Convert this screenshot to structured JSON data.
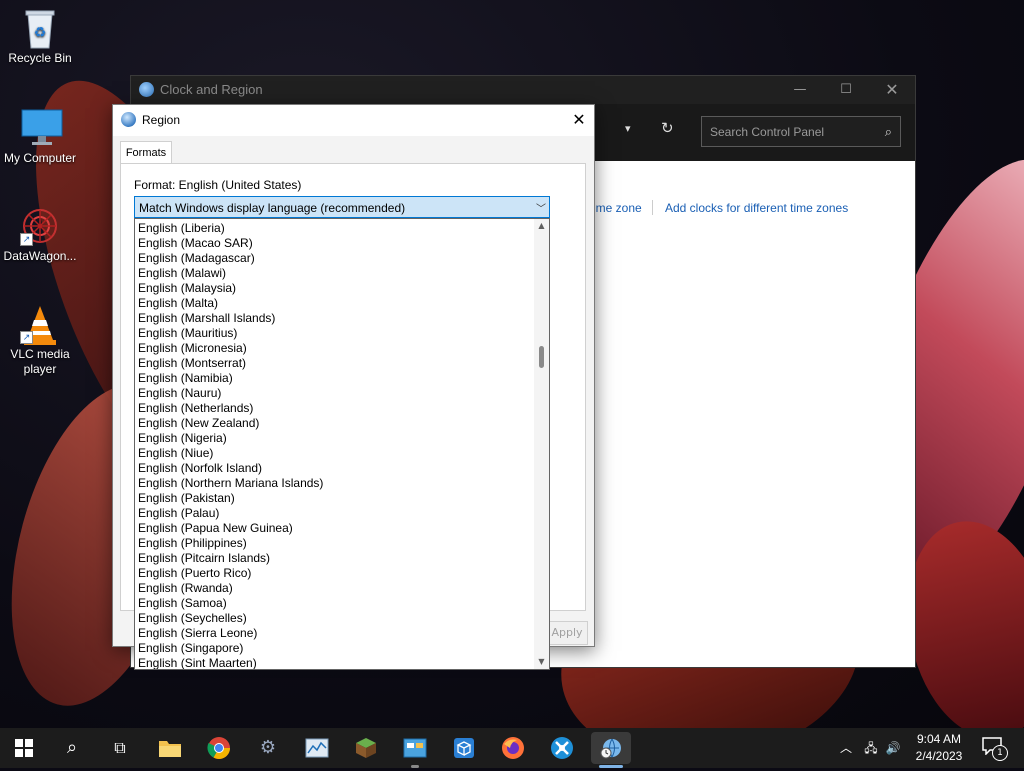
{
  "desktop": {
    "icons": [
      {
        "label": "Recycle Bin"
      },
      {
        "label": "My Computer"
      },
      {
        "label": "DataWagon..."
      },
      {
        "label": "VLC media player"
      }
    ]
  },
  "control_panel": {
    "title": "Clock and Region",
    "search_placeholder": "Search Control Panel",
    "link_time_zone": "ime zone",
    "link_add_clocks": "Add clocks for different time zones"
  },
  "region_dialog": {
    "title": "Region",
    "tab_formats": "Formats",
    "format_label": "Format: English (United States)",
    "selected_format": "Match Windows display language (recommended)",
    "apply_label": "Apply",
    "options": [
      "English (Liberia)",
      "English (Macao SAR)",
      "English (Madagascar)",
      "English (Malawi)",
      "English (Malaysia)",
      "English (Malta)",
      "English (Marshall Islands)",
      "English (Mauritius)",
      "English (Micronesia)",
      "English (Montserrat)",
      "English (Namibia)",
      "English (Nauru)",
      "English (Netherlands)",
      "English (New Zealand)",
      "English (Nigeria)",
      "English (Niue)",
      "English (Norfolk Island)",
      "English (Northern Mariana Islands)",
      "English (Pakistan)",
      "English (Palau)",
      "English (Papua New Guinea)",
      "English (Philippines)",
      "English (Pitcairn Islands)",
      "English (Puerto Rico)",
      "English (Rwanda)",
      "English (Samoa)",
      "English (Seychelles)",
      "English (Sierra Leone)",
      "English (Singapore)",
      "English (Sint Maarten)"
    ]
  },
  "taskbar": {
    "time": "9:04 AM",
    "date": "2/4/2023",
    "notification_count": "1"
  },
  "colors": {
    "accent": "#0078d4",
    "link": "#1a5fb4",
    "selection_bg": "#cce4f7",
    "taskbar_bg": "#1c1c1c"
  }
}
